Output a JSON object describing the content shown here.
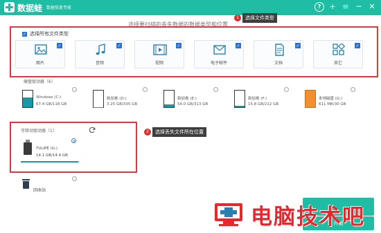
{
  "app": {
    "name": "数据蛙",
    "subtitle": "数据恢复专家"
  },
  "titlebar": {
    "icons": [
      "help-icon",
      "add-icon",
      "menu-icon",
      "minimize-icon",
      "close-icon"
    ],
    "glyphs": {
      "help": "?",
      "add": "+",
      "menu": "≡",
      "minimize": "─",
      "close": "✕"
    }
  },
  "prompt": "选择要扫描的丢失数据的数据类型和位置",
  "callouts": [
    {
      "number": "1",
      "text": "选择文件类型"
    },
    {
      "number": "2",
      "text": "选择丢失文件所在位置"
    }
  ],
  "file_types": {
    "select_all_label": "选择所有文件类型",
    "select_all_checked": true,
    "items": [
      {
        "label": "图片",
        "icon": "image-icon",
        "checked": true
      },
      {
        "label": "音频",
        "icon": "audio-icon",
        "checked": true
      },
      {
        "label": "视频",
        "icon": "video-icon",
        "checked": true
      },
      {
        "label": "电子邮件",
        "icon": "email-icon",
        "checked": true
      },
      {
        "label": "文档",
        "icon": "document-icon",
        "checked": true
      },
      {
        "label": "其它",
        "icon": "other-icon",
        "checked": true
      }
    ]
  },
  "hard_drives": {
    "section_label": "硬盘驱动器（6）",
    "items": [
      {
        "name": "Windows (C:)",
        "size": "67.4 GB/118 GB",
        "used_fraction": 0.57,
        "selected": false
      },
      {
        "name": "新加卷 (D:)",
        "size": "3.25 GB/335 GB",
        "used_fraction": 0.01,
        "selected": false
      },
      {
        "name": "新加卷 (E:)",
        "size": "54.0 GB/313 GB",
        "used_fraction": 0.17,
        "selected": false
      },
      {
        "name": "新加卷 (F:)",
        "size": "15.8 GB/212 GB",
        "used_fraction": 0.07,
        "selected": false
      },
      {
        "name": "本地磁盘 (G:)",
        "size": "611 MB/30 GB",
        "used_fraction": 1.0,
        "selected": false
      }
    ]
  },
  "removable": {
    "section_label": "可移动驱动器（1）",
    "items": [
      {
        "name": "TULIPE (G:)",
        "size": "14.1 GB/14.4 GB",
        "used_fraction": 0.98,
        "selected": true
      }
    ]
  },
  "recycle": {
    "label": "回收站"
  },
  "buttons": {
    "scan_label": "扫描",
    "start_label": "开始"
  },
  "watermark": "电脑技术吧",
  "colors": {
    "accent": "#1fbda3",
    "callout_red": "#d63a3a",
    "checkbox_blue": "#2f72d2",
    "drive_fill": "#1c97a7"
  }
}
